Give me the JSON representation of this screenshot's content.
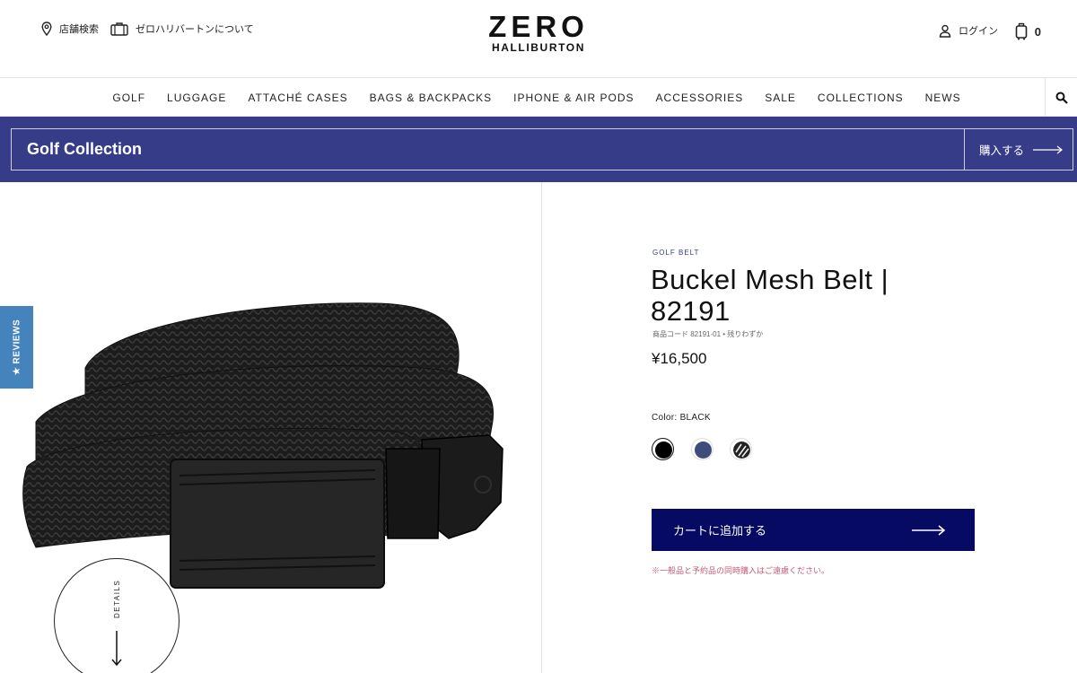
{
  "header": {
    "store_search": "店舗検索",
    "about": "ゼロハリバートンについて",
    "logo_line1": "ZERO",
    "logo_line2": "HALLIBURTON",
    "login": "ログイン",
    "cart_count": "0"
  },
  "nav": {
    "items": [
      "GOLF",
      "LUGGAGE",
      "ATTACHÉ CASES",
      "BAGS & BACKPACKS",
      "IPHONE & AIR PODS",
      "ACCESSORIES",
      "SALE",
      "COLLECTIONS",
      "NEWS"
    ]
  },
  "banner": {
    "title": "Golf Collection",
    "buy_label": "購入する"
  },
  "sidebar": {
    "reviews": "★ REVIEWS",
    "details": "DETAILS"
  },
  "product": {
    "category": "GOLF BELT",
    "title": "Buckel Mesh Belt | 82191",
    "sku": "商品コード 82191-01 • 残りわずか",
    "price": "¥16,500",
    "color_label": "Color:",
    "color_value": "BLACK",
    "swatches": [
      {
        "name": "black",
        "color": "#000000"
      },
      {
        "name": "navy",
        "color": "#3e4c7c"
      },
      {
        "name": "pattern",
        "color": "#222222"
      }
    ],
    "add_to_cart": "カートに追加する",
    "note": "※一般品と予約品の同時購入はご遠慮ください。"
  },
  "colors": {
    "banner": "#363c88",
    "cart_button": "#060a63",
    "reviews_tab": "#4583bd",
    "note_text": "#c25b76"
  }
}
